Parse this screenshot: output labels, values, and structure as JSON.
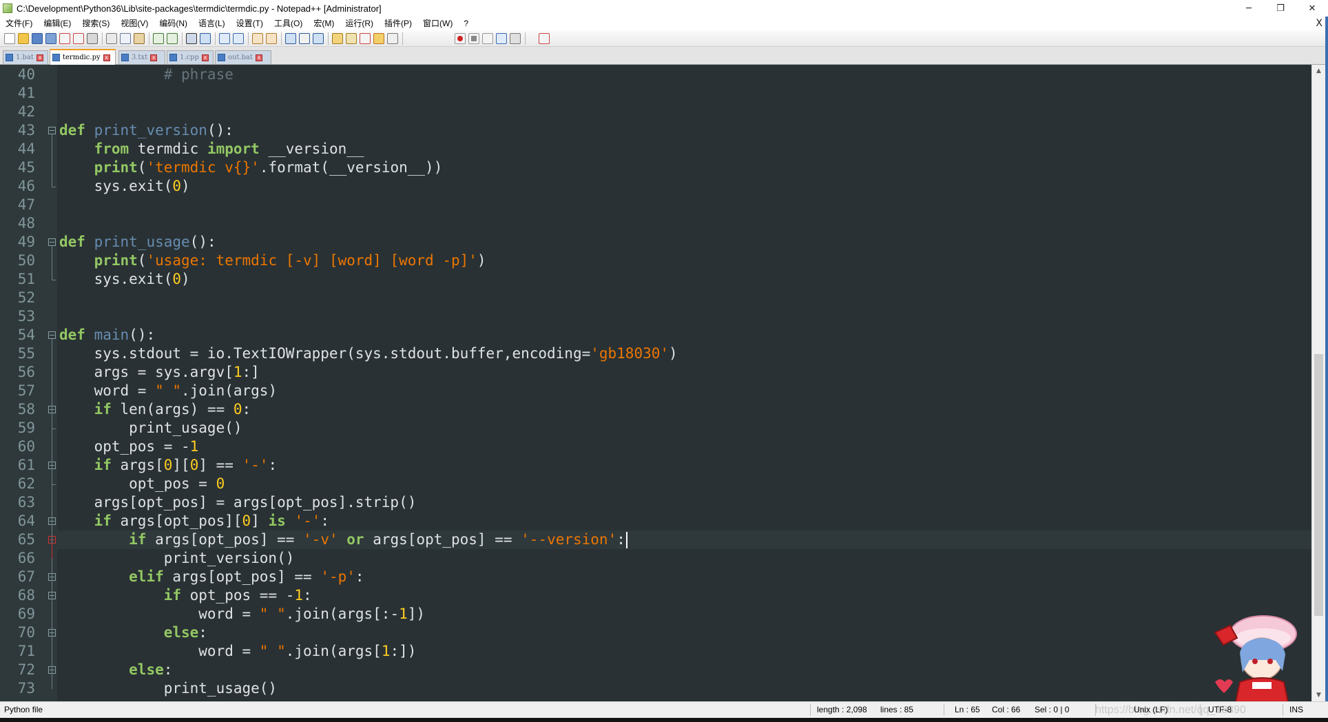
{
  "window": {
    "title": "C:\\Development\\Python36\\Lib\\site-packages\\termdic\\termdic.py - Notepad++ [Administrator]",
    "minimize_label": "─",
    "restore_label": "❐",
    "close_label": "✕"
  },
  "menu": {
    "items": [
      "文件(F)",
      "编辑(E)",
      "搜索(S)",
      "视图(V)",
      "编码(N)",
      "语言(L)",
      "设置(T)",
      "工具(O)",
      "宏(M)",
      "运行(R)",
      "插件(P)",
      "窗口(W)",
      "?"
    ],
    "close_label": "X"
  },
  "tabs": [
    {
      "label": "1.bat",
      "active": false
    },
    {
      "label": "termdic.py",
      "active": true
    },
    {
      "label": "3.txt",
      "active": false
    },
    {
      "label": "1.cpp",
      "active": false
    },
    {
      "label": "out.bat",
      "active": false
    }
  ],
  "tab_close_glyph": "x",
  "editor": {
    "language": "Python",
    "theme_colors": {
      "background": "#293134",
      "gutter": "#2f393c",
      "keyword": "#93c763",
      "function": "#678cb1",
      "string": "#ec7600",
      "number": "#ffcd22",
      "comment": "#66747b",
      "text": "#e0e2e4"
    },
    "current_line": 65,
    "lines": [
      {
        "n": "40",
        "tokens": [
          [
            "",
            "            "
          ],
          [
            "cmt",
            "# phrase"
          ]
        ]
      },
      {
        "n": "41",
        "tokens": []
      },
      {
        "n": "42",
        "tokens": []
      },
      {
        "n": "43",
        "tokens": [
          [
            "kw",
            "def"
          ],
          [
            "",
            " "
          ],
          [
            "fn",
            "print_version"
          ],
          [
            "",
            "():"
          ]
        ]
      },
      {
        "n": "44",
        "tokens": [
          [
            "",
            "    "
          ],
          [
            "kw",
            "from"
          ],
          [
            "",
            " termdic "
          ],
          [
            "kw",
            "import"
          ],
          [
            "",
            " __version__"
          ]
        ]
      },
      {
        "n": "45",
        "tokens": [
          [
            "",
            "    "
          ],
          [
            "kw",
            "print"
          ],
          [
            "",
            "("
          ],
          [
            "str",
            "'termdic v{}'"
          ],
          [
            "",
            ".format(__version__))"
          ]
        ]
      },
      {
        "n": "46",
        "tokens": [
          [
            "",
            "    sys.exit("
          ],
          [
            "num",
            "0"
          ],
          [
            "",
            ")"
          ]
        ]
      },
      {
        "n": "47",
        "tokens": []
      },
      {
        "n": "48",
        "tokens": []
      },
      {
        "n": "49",
        "tokens": [
          [
            "kw",
            "def"
          ],
          [
            "",
            " "
          ],
          [
            "fn",
            "print_usage"
          ],
          [
            "",
            "():"
          ]
        ]
      },
      {
        "n": "50",
        "tokens": [
          [
            "",
            "    "
          ],
          [
            "kw",
            "print"
          ],
          [
            "",
            "("
          ],
          [
            "str",
            "'usage: termdic [-v] [word] [word -p]'"
          ],
          [
            "",
            ")"
          ]
        ]
      },
      {
        "n": "51",
        "tokens": [
          [
            "",
            "    sys.exit("
          ],
          [
            "num",
            "0"
          ],
          [
            "",
            ")"
          ]
        ]
      },
      {
        "n": "52",
        "tokens": []
      },
      {
        "n": "53",
        "tokens": []
      },
      {
        "n": "54",
        "tokens": [
          [
            "kw",
            "def"
          ],
          [
            "",
            " "
          ],
          [
            "fn",
            "main"
          ],
          [
            "",
            "():"
          ]
        ]
      },
      {
        "n": "55",
        "tokens": [
          [
            "",
            "    sys.stdout = io.TextIOWrapper(sys.stdout.buffer,encoding="
          ],
          [
            "str",
            "'gb18030'"
          ],
          [
            "",
            ")"
          ]
        ]
      },
      {
        "n": "56",
        "tokens": [
          [
            "",
            "    args = sys.argv["
          ],
          [
            "num",
            "1"
          ],
          [
            "",
            ":]"
          ]
        ]
      },
      {
        "n": "57",
        "tokens": [
          [
            "",
            "    word = "
          ],
          [
            "str",
            "\" \""
          ],
          [
            "",
            ".join(args)"
          ]
        ]
      },
      {
        "n": "58",
        "tokens": [
          [
            "",
            "    "
          ],
          [
            "kw",
            "if"
          ],
          [
            "",
            " len(args) == "
          ],
          [
            "num",
            "0"
          ],
          [
            "",
            ":"
          ]
        ]
      },
      {
        "n": "59",
        "tokens": [
          [
            "",
            "        print_usage()"
          ]
        ]
      },
      {
        "n": "60",
        "tokens": [
          [
            "",
            "    opt_pos = -"
          ],
          [
            "num",
            "1"
          ]
        ]
      },
      {
        "n": "61",
        "tokens": [
          [
            "",
            "    "
          ],
          [
            "kw",
            "if"
          ],
          [
            "",
            " args["
          ],
          [
            "num",
            "0"
          ],
          [
            "",
            "]["
          ],
          [
            "num",
            "0"
          ],
          [
            "",
            "] == "
          ],
          [
            "str",
            "'-'"
          ],
          [
            "",
            ":"
          ]
        ]
      },
      {
        "n": "62",
        "tokens": [
          [
            "",
            "        opt_pos = "
          ],
          [
            "num",
            "0"
          ]
        ]
      },
      {
        "n": "63",
        "tokens": [
          [
            "",
            "    args[opt_pos] = args[opt_pos].strip()"
          ]
        ]
      },
      {
        "n": "64",
        "tokens": [
          [
            "",
            "    "
          ],
          [
            "kw",
            "if"
          ],
          [
            "",
            " args[opt_pos]["
          ],
          [
            "num",
            "0"
          ],
          [
            "",
            "] "
          ],
          [
            "kw",
            "is"
          ],
          [
            "",
            " "
          ],
          [
            "str",
            "'-'"
          ],
          [
            "",
            ":"
          ]
        ]
      },
      {
        "n": "65",
        "tokens": [
          [
            "",
            "        "
          ],
          [
            "kw",
            "if"
          ],
          [
            "",
            " args[opt_pos] == "
          ],
          [
            "str",
            "'-v'"
          ],
          [
            "",
            " "
          ],
          [
            "kw",
            "or"
          ],
          [
            "",
            " args[opt_pos] == "
          ],
          [
            "str",
            "'--version'"
          ],
          [
            "",
            ":"
          ]
        ]
      },
      {
        "n": "66",
        "tokens": [
          [
            "",
            "            print_version()"
          ]
        ]
      },
      {
        "n": "67",
        "tokens": [
          [
            "",
            "        "
          ],
          [
            "kw",
            "elif"
          ],
          [
            "",
            " args[opt_pos] == "
          ],
          [
            "str",
            "'-p'"
          ],
          [
            "",
            ":"
          ]
        ]
      },
      {
        "n": "68",
        "tokens": [
          [
            "",
            "            "
          ],
          [
            "kw",
            "if"
          ],
          [
            "",
            " opt_pos == -"
          ],
          [
            "num",
            "1"
          ],
          [
            "",
            ":"
          ]
        ]
      },
      {
        "n": "69",
        "tokens": [
          [
            "",
            "                word = "
          ],
          [
            "str",
            "\" \""
          ],
          [
            "",
            ".join(args[:-"
          ],
          [
            "num",
            "1"
          ],
          [
            "",
            "])"
          ]
        ]
      },
      {
        "n": "70",
        "tokens": [
          [
            "",
            "            "
          ],
          [
            "kw",
            "else"
          ],
          [
            "",
            ":"
          ]
        ]
      },
      {
        "n": "71",
        "tokens": [
          [
            "",
            "                word = "
          ],
          [
            "str",
            "\" \""
          ],
          [
            "",
            ".join(args["
          ],
          [
            "num",
            "1"
          ],
          [
            "",
            ":])"
          ]
        ]
      },
      {
        "n": "72",
        "tokens": [
          [
            "",
            "        "
          ],
          [
            "kw",
            "else"
          ],
          [
            "",
            ":"
          ]
        ]
      },
      {
        "n": "73",
        "tokens": [
          [
            "",
            "            print_usage()"
          ]
        ]
      }
    ]
  },
  "statusbar": {
    "file_type": "Python file",
    "length": "length : 2,098",
    "lines": "lines : 85",
    "ln": "Ln : 65",
    "col": "Col : 66",
    "sel": "Sel : 0 | 0",
    "eol": "Unix (LF)",
    "encoding": "UTF-8",
    "mode": "INS",
    "watermark": "https://blog.csdn.net/qq_18390"
  },
  "icons": {
    "toolbar": [
      "new-file-icon",
      "open-file-icon",
      "save-icon",
      "save-all-icon",
      "close-icon",
      "close-all-icon",
      "print-icon",
      "cut-icon",
      "copy-icon",
      "paste-icon",
      "undo-icon",
      "redo-icon",
      "find-icon",
      "replace-icon",
      "zoom-in-icon",
      "zoom-out-icon",
      "sync-vertical-icon",
      "sync-horizontal-icon",
      "word-wrap-icon",
      "show-all-chars-icon",
      "indent-guide-icon",
      "user-lang-icon",
      "doc-map-icon",
      "function-list-icon",
      "folder-workspace-icon",
      "monitoring-icon",
      "record-macro-icon",
      "stop-record-icon",
      "play-macro-icon",
      "run-macro-multiple-icon",
      "save-macro-icon",
      "spell-check-icon"
    ]
  }
}
